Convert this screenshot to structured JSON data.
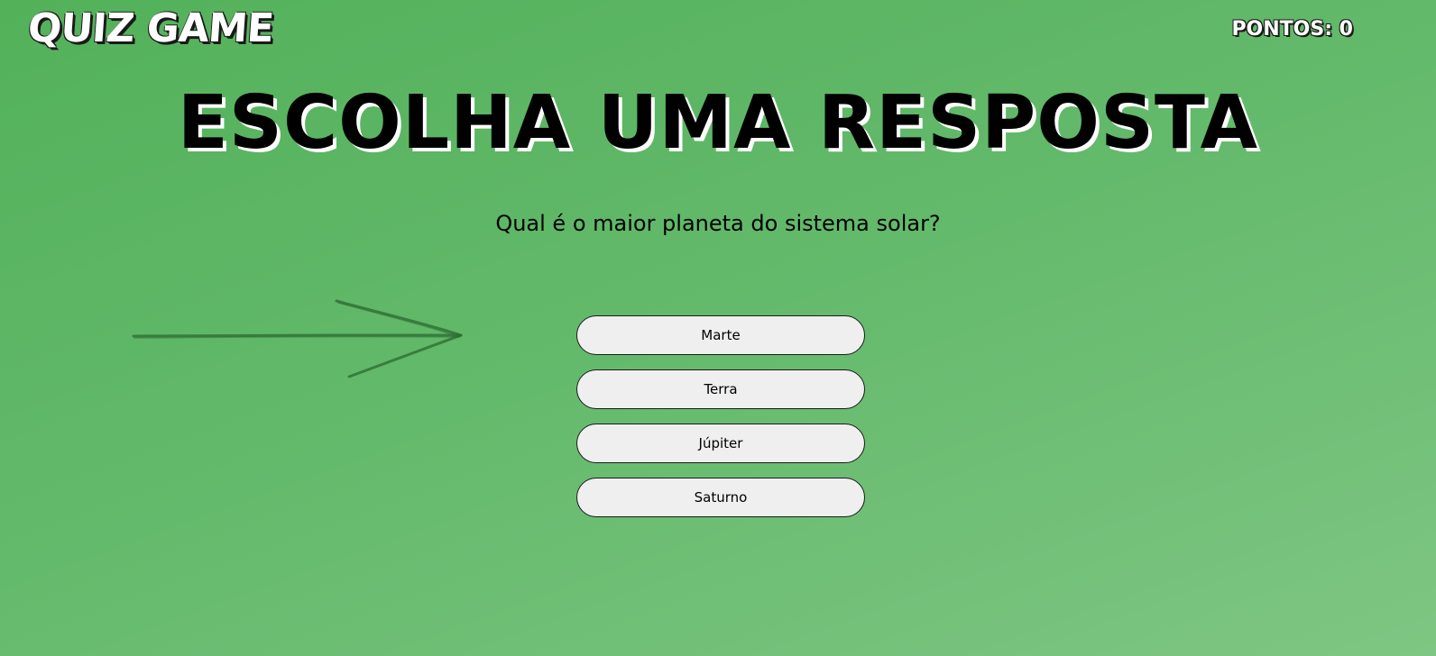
{
  "header": {
    "logo_text": "QUIZ GAME",
    "score_text": "PONTOS: 0"
  },
  "main": {
    "headline": "ESCOLHA UMA RESPOSTA",
    "question": "Qual é o maior planeta do sistema solar?",
    "answers": [
      {
        "label": "Marte"
      },
      {
        "label": "Terra"
      },
      {
        "label": "Júpiter"
      },
      {
        "label": "Saturno"
      }
    ]
  },
  "decor": {
    "arrow_icon": "hand-drawn-arrow-right",
    "arrow_color": "#2e6e33"
  },
  "colors": {
    "background_start": "#53b15a",
    "background_end": "#7ec683",
    "button_bg": "#efefef"
  }
}
